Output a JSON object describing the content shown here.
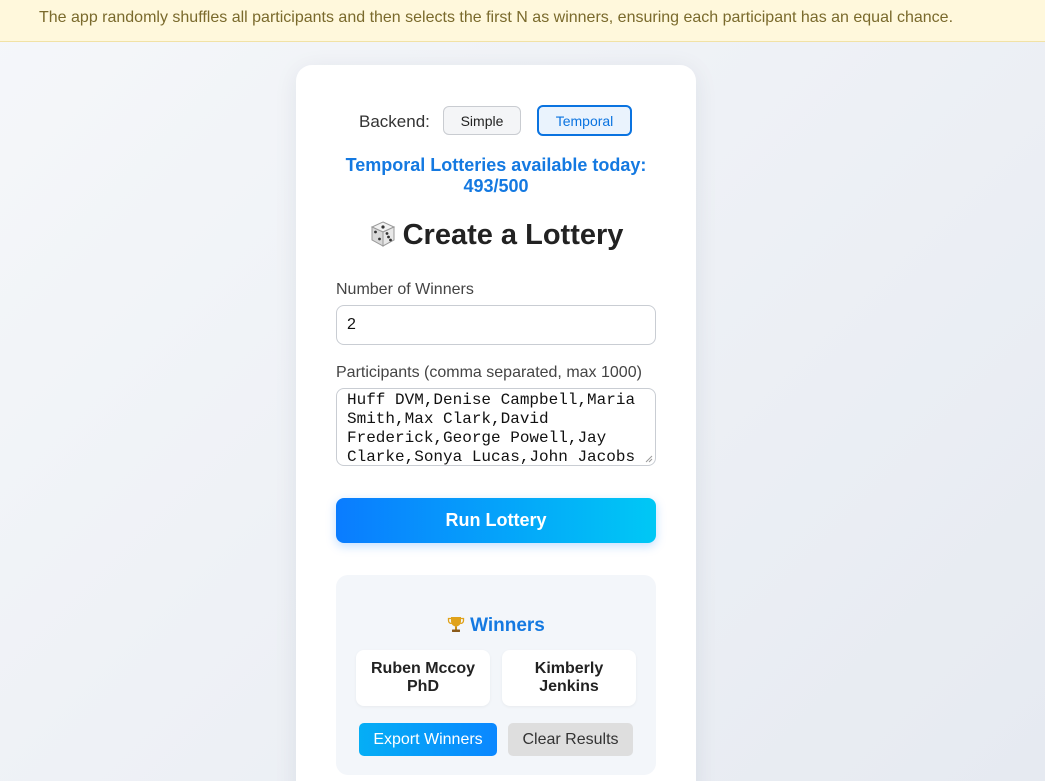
{
  "banner": {
    "text": "The app randomly shuffles all participants and then selects the first N as winners, ensuring each participant has an equal chance."
  },
  "backend": {
    "label": "Backend:",
    "options": [
      "Simple",
      "Temporal"
    ],
    "selected": "Temporal"
  },
  "quota": {
    "line1": "Temporal Lotteries available today:",
    "line2": "493/500"
  },
  "header": {
    "icon": "dice-icon",
    "title": "Create a Lottery"
  },
  "form": {
    "winners_label": "Number of Winners",
    "winners_value": "2",
    "participants_label": "Participants (comma separated, max 1000)",
    "participants_value": "Huff DVM,Denise Campbell,Maria Smith,Max Clark,David Frederick,George Powell,Jay Clarke,Sonya Lucas,John Jacobs",
    "run_label": "Run Lottery"
  },
  "results": {
    "icon": "trophy-icon",
    "heading": "Winners",
    "winners": [
      "Ruben Mccoy PhD",
      "Kimberly Jenkins"
    ],
    "export_label": "Export Winners",
    "clear_label": "Clear Results"
  },
  "colors": {
    "accent": "#1479e1",
    "banner_bg": "#fff8dc",
    "banner_text": "#7a6a2c",
    "run_gradient_start": "#0a7cff",
    "run_gradient_end": "#00c8f5"
  }
}
